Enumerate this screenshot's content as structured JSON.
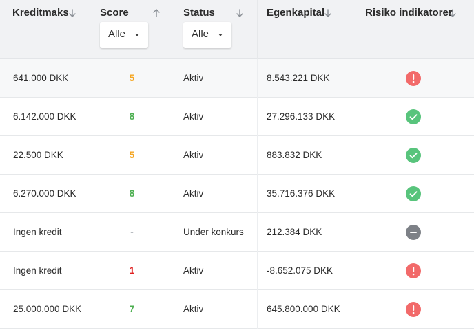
{
  "columns": [
    {
      "label": "Kreditmaks",
      "sort_icon": "arrow-down-icon"
    },
    {
      "label": "Score",
      "sort_icon": "arrow-up-icon"
    },
    {
      "label": "Status",
      "sort_icon": "arrow-down-icon"
    },
    {
      "label": "Egenkapital",
      "sort_icon": "arrow-down-icon"
    },
    {
      "label": "Risiko indikatorer",
      "sort_icon": "arrow-down-icon"
    }
  ],
  "filters": {
    "score": {
      "value": "Alle"
    },
    "status": {
      "value": "Alle"
    }
  },
  "colors": {
    "score_green": "#4caf50",
    "score_orange": "#f5a623",
    "score_red": "#e02020",
    "score_dash": "#b8bcc1",
    "risk_danger": "#f26a6a",
    "risk_ok": "#58c47c",
    "risk_neutral": "#7d8187"
  },
  "rows": [
    {
      "kreditmaks": "641.000 DKK",
      "score": "5",
      "score_color": "#f5a623",
      "status": "Aktiv",
      "egenkapital": "8.543.221 DKK",
      "risk": "warning-icon"
    },
    {
      "kreditmaks": "6.142.000 DKK",
      "score": "8",
      "score_color": "#4caf50",
      "status": "Aktiv",
      "egenkapital": "27.296.133 DKK",
      "risk": "check-icon"
    },
    {
      "kreditmaks": "22.500 DKK",
      "score": "5",
      "score_color": "#f5a623",
      "status": "Aktiv",
      "egenkapital": "883.832 DKK",
      "risk": "check-icon"
    },
    {
      "kreditmaks": "6.270.000 DKK",
      "score": "8",
      "score_color": "#4caf50",
      "status": "Aktiv",
      "egenkapital": "35.716.376 DKK",
      "risk": "check-icon"
    },
    {
      "kreditmaks": "Ingen kredit",
      "score": "-",
      "score_color": "#b8bcc1",
      "status": "Under konkurs",
      "egenkapital": "212.384 DKK",
      "risk": "minus-icon"
    },
    {
      "kreditmaks": "Ingen kredit",
      "score": "1",
      "score_color": "#e02020",
      "status": "Aktiv",
      "egenkapital": "-8.652.075 DKK",
      "risk": "warning-icon"
    },
    {
      "kreditmaks": "25.000.000 DKK",
      "score": "7",
      "score_color": "#4caf50",
      "status": "Aktiv",
      "egenkapital": "645.800.000 DKK",
      "risk": "warning-icon"
    }
  ]
}
